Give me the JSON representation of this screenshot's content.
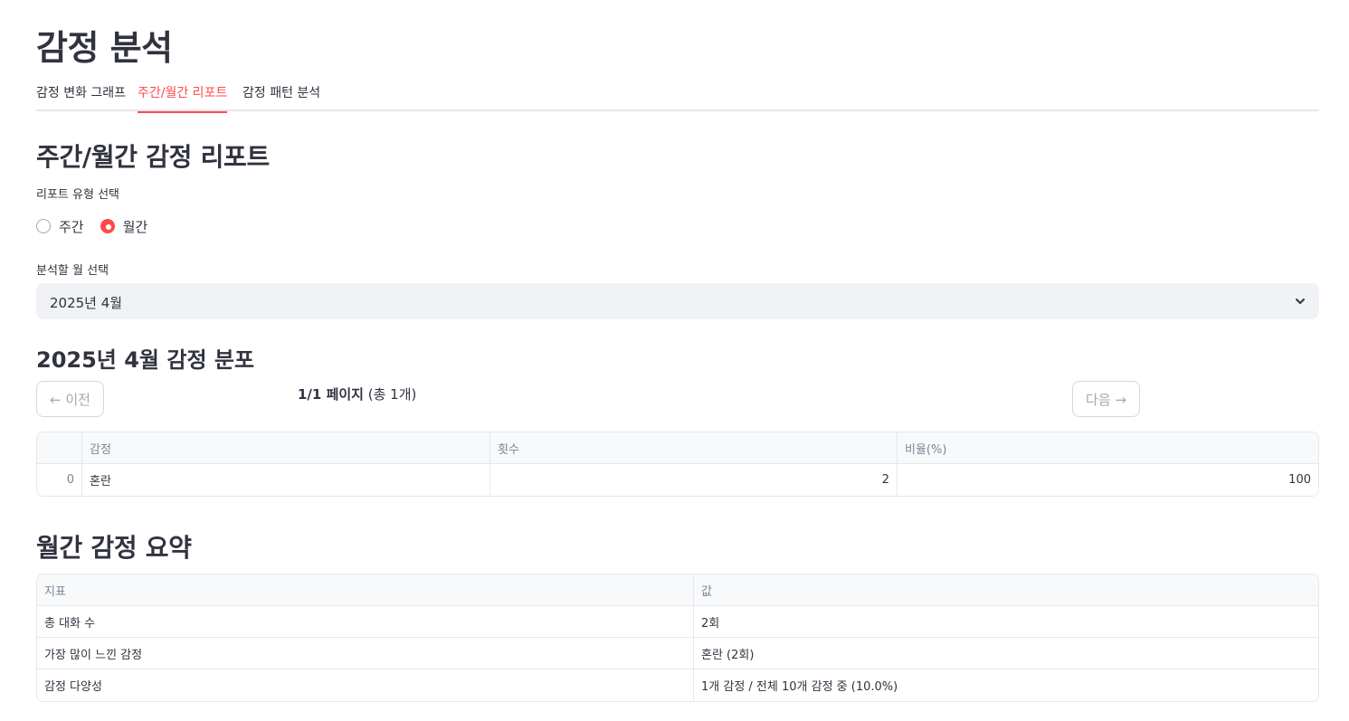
{
  "title": "감정 분석",
  "tabs": [
    {
      "label": "감정 변화 그래프",
      "active": false
    },
    {
      "label": "주간/월간 리포트",
      "active": true
    },
    {
      "label": "감정 패턴 분석",
      "active": false
    }
  ],
  "report": {
    "heading": "주간/월간 감정 리포트",
    "type_label": "리포트 유형 선택",
    "options": [
      {
        "label": "주간",
        "checked": false
      },
      {
        "label": "월간",
        "checked": true
      }
    ],
    "month_label": "분석할 월 선택",
    "month_value": "2025년 4월"
  },
  "distribution": {
    "heading": "2025년 4월 감정 분포",
    "prev_label": "← 이전",
    "next_label": "다음 →",
    "page_bold": "1/1 페이지",
    "page_rest": " (총 1개)",
    "columns": [
      "",
      "감정",
      "횟수",
      "비율(%)"
    ],
    "rows": [
      {
        "index": "0",
        "emotion": "혼란",
        "count": "2",
        "ratio": "100"
      }
    ]
  },
  "summary": {
    "heading": "월간 감정 요약",
    "columns": [
      "지표",
      "값"
    ],
    "rows": [
      {
        "metric": "총 대화 수",
        "value": "2회"
      },
      {
        "metric": "가장 많이 느낀 감정",
        "value": "혼란 (2회)"
      },
      {
        "metric": "감정 다양성",
        "value": "1개 감정 / 전체 10개 감정 중 (10.0%)"
      }
    ]
  },
  "colors": {
    "accent": "#ff4b4b",
    "text": "#31333f",
    "muted": "#808495",
    "select_bg": "#f0f2f6"
  },
  "icons": {
    "select": "chevron-down-icon"
  }
}
